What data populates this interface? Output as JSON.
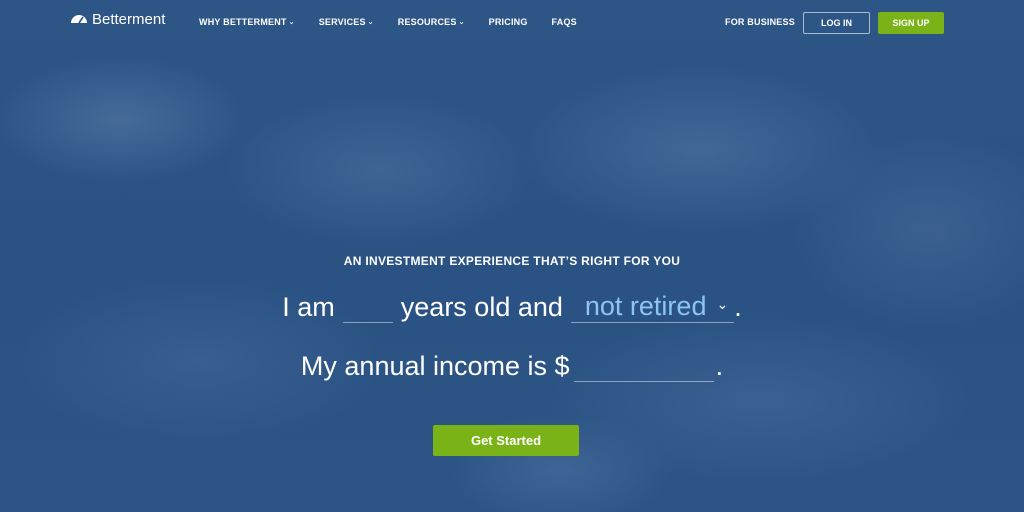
{
  "brand": {
    "name": "Betterment",
    "logo_icon": "gauge-icon"
  },
  "nav": {
    "links": [
      {
        "label": "WHY BETTERMENT",
        "has_dropdown": true
      },
      {
        "label": "SERVICES",
        "has_dropdown": true
      },
      {
        "label": "RESOURCES",
        "has_dropdown": true
      },
      {
        "label": "PRICING",
        "has_dropdown": false
      },
      {
        "label": "FAQS",
        "has_dropdown": false
      }
    ],
    "for_business": "FOR BUSINESS",
    "login": "LOG IN",
    "signup": "SIGN UP"
  },
  "hero": {
    "tagline": "AN INVESTMENT EXPERIENCE THAT’S RIGHT FOR YOU",
    "line1_prefix": "I am",
    "line1_middle": "years old and",
    "age_value": "",
    "retirement_select": "not retired",
    "line1_suffix": ".",
    "line2_prefix": "My annual income is $",
    "income_value": "",
    "line2_suffix": ".",
    "cta": "Get Started"
  },
  "colors": {
    "background": "#2b5486",
    "accent_green": "#7ab317",
    "select_text": "#8ec4f0",
    "text": "#ffffff"
  }
}
